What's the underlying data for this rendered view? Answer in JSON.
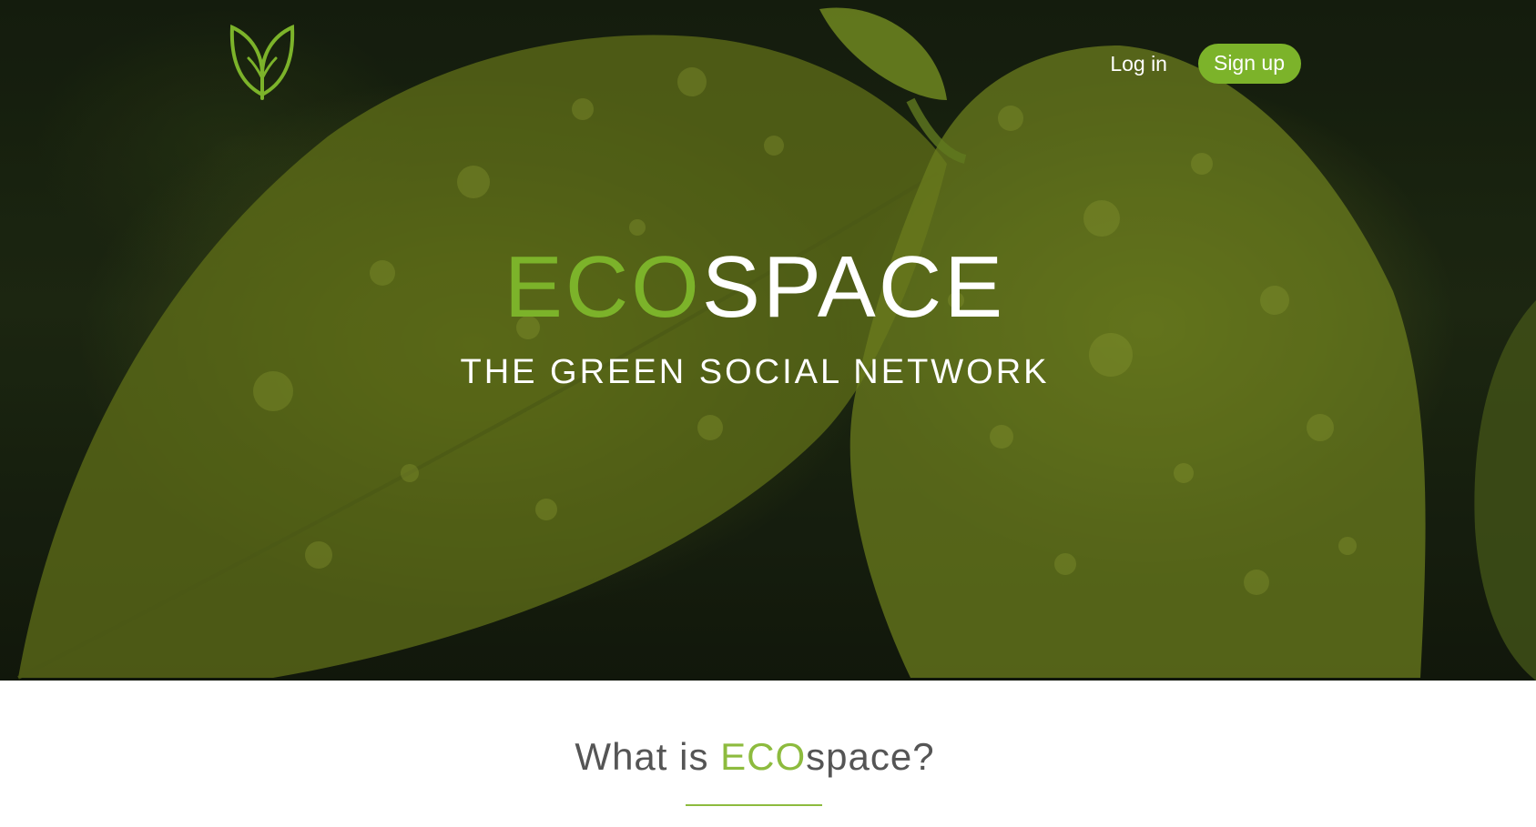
{
  "header": {
    "logo_icon": "leaf-icon",
    "login_label": "Log in",
    "signup_label": "Sign up"
  },
  "hero": {
    "title_eco": "ECO",
    "title_space": "SPACE",
    "subtitle": "THE GREEN SOCIAL NETWORK",
    "background": "green-leaves-with-water-droplets"
  },
  "about": {
    "title_prefix": "What is ",
    "title_eco": "ECO",
    "title_suffix": "space?"
  },
  "colors": {
    "accent": "#7cb32a",
    "heading_text": "#555555",
    "white": "#ffffff"
  }
}
